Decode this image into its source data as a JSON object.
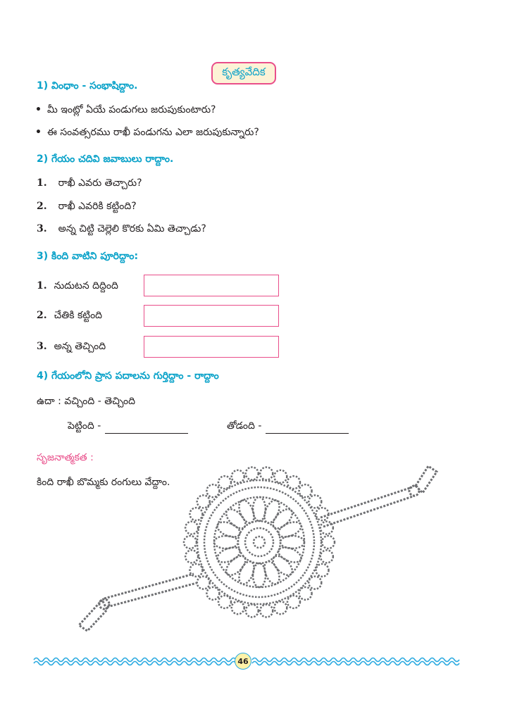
{
  "title": "కృత్యవేదిక",
  "s1": {
    "heading": "1) వింధాం - సంభాషిద్దాం.",
    "q1": "మీ ఇంట్లో ఏయే పండుగలు జరుపుకుంటారు?",
    "q2": "ఈ సంవత్సరము రాఖీ పండుగను ఎలా జరుపుకున్నారు?"
  },
  "s2": {
    "heading": "2) గేయం చదివి జవాబులు రాద్దాం.",
    "items": [
      {
        "num": "1.",
        "text": "రాఖీ ఎవరు తెచ్చారు?"
      },
      {
        "num": "2.",
        "text": "రాఖీ ఎవరికి కట్టింది?"
      },
      {
        "num": "3.",
        "text": "అన్న చిట్టి చెల్లెలి కొరకు ఏమి తెచ్చాడు?"
      }
    ]
  },
  "s3": {
    "heading": "3) కింది వాటిని పూరిద్దాం:",
    "items": [
      {
        "num": "1.",
        "text": "నుదుటన దిద్దింది"
      },
      {
        "num": "2.",
        "text": "చేతికి కట్టింది"
      },
      {
        "num": "3.",
        "text": "అన్న తెచ్చింది"
      }
    ]
  },
  "s4": {
    "heading": "4) గేయంలోని ప్రాస పదాలను గుర్తిద్దాం - రాద్దాం",
    "example": "ఉదా : వచ్చింది - తెచ్చింది",
    "fill1": "పెట్టింది -",
    "fill2": "తోడంది -"
  },
  "creative": {
    "heading": "సృజనాత్మకత :",
    "instruction": "కింది రాఖీ బొమ్మకు రంగులు వేద్దాం."
  },
  "page_number": "46",
  "colors": {
    "heading": "#0aa2c9",
    "accent": "#e94e8a",
    "wave": "#29a9e0"
  }
}
